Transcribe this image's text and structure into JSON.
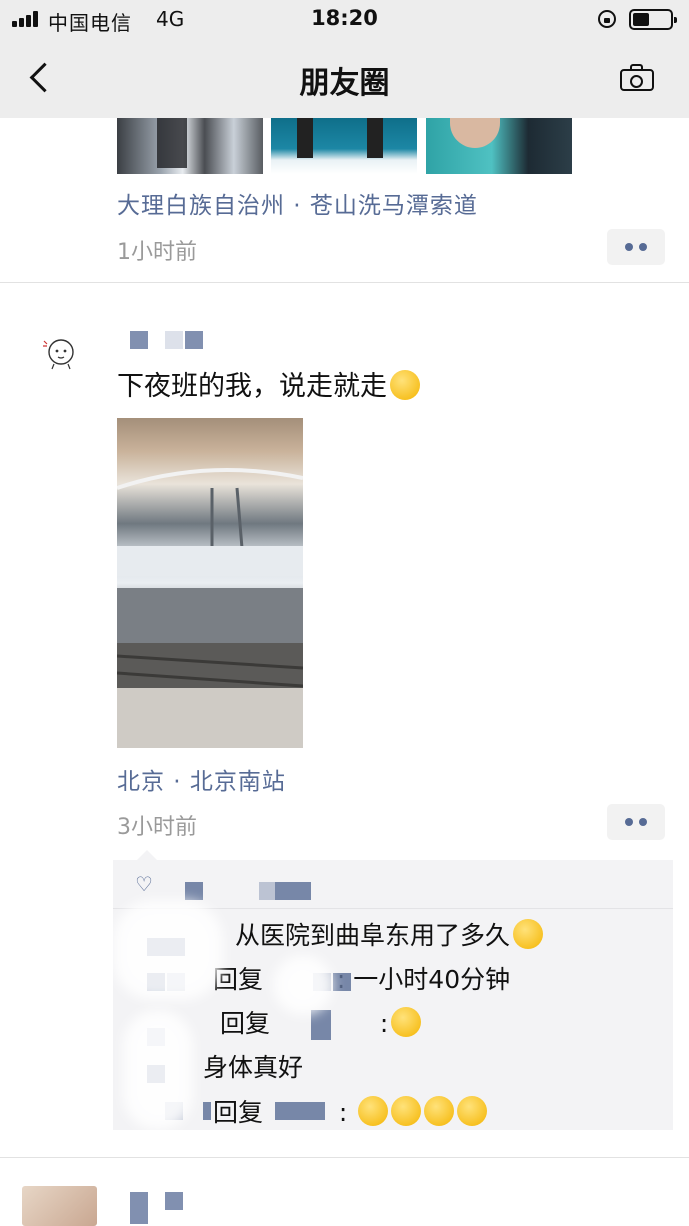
{
  "status_bar": {
    "carrier": "中国电信",
    "network": "4G",
    "time": "18:20"
  },
  "nav": {
    "title": "朋友圈"
  },
  "posts": [
    {
      "location": "大理白族自治州 · 苍山洗马潭索道",
      "time": "1小时前"
    },
    {
      "text": "下夜班的我，说走就走",
      "location": "北京 · 北京南站",
      "time": "3小时前",
      "comments": [
        {
          "prefix": "",
          "text": "从医院到曲阜东用了多久"
        },
        {
          "prefix": "回复",
          "text": ": 一小时40分钟"
        },
        {
          "prefix": "回复",
          "text": ":"
        },
        {
          "prefix": "",
          "text": "身体真好"
        },
        {
          "prefix": "回复",
          "text": ":"
        }
      ]
    }
  ],
  "colors": {
    "link": "#576b95",
    "time": "#9a9a9a",
    "nav_bg": "#ededed",
    "comment_bg": "#f3f3f5"
  },
  "icons": [
    "signal-icon",
    "orientation-lock-icon",
    "battery-icon",
    "back-icon",
    "camera-icon",
    "more-icon",
    "heart-icon",
    "emoji-icon"
  ]
}
